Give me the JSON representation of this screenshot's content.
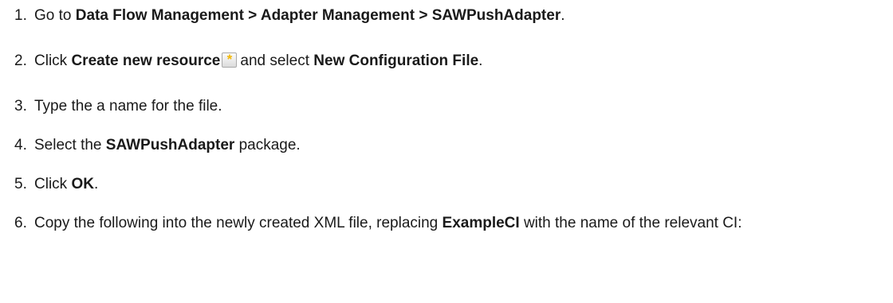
{
  "steps": [
    {
      "num": "1.",
      "parts": [
        {
          "t": "Go to "
        },
        {
          "t": "Data Flow Management > Adapter Management > SAWPushAdapter",
          "b": true
        },
        {
          "t": "."
        }
      ]
    },
    {
      "num": "2.",
      "parts": [
        {
          "t": "Click "
        },
        {
          "t": "Create new resource",
          "b": true
        },
        {
          "icon": "create-new-resource-icon",
          "glyph": "*"
        },
        {
          "t": "and select "
        },
        {
          "t": "New Configuration File",
          "b": true
        },
        {
          "t": "."
        }
      ]
    },
    {
      "num": "3.",
      "parts": [
        {
          "t": "Type the a name for the file."
        }
      ]
    },
    {
      "num": "4.",
      "parts": [
        {
          "t": "Select the "
        },
        {
          "t": "SAWPushAdapter",
          "b": true
        },
        {
          "t": " package."
        }
      ]
    },
    {
      "num": "5.",
      "parts": [
        {
          "t": "Click "
        },
        {
          "t": "OK",
          "b": true
        },
        {
          "t": "."
        }
      ]
    },
    {
      "num": "6.",
      "parts": [
        {
          "t": "Copy the following into the newly created XML file, replacing "
        },
        {
          "t": "ExampleCI",
          "b": true
        },
        {
          "t": " with the name of the relevant CI:"
        }
      ]
    }
  ]
}
